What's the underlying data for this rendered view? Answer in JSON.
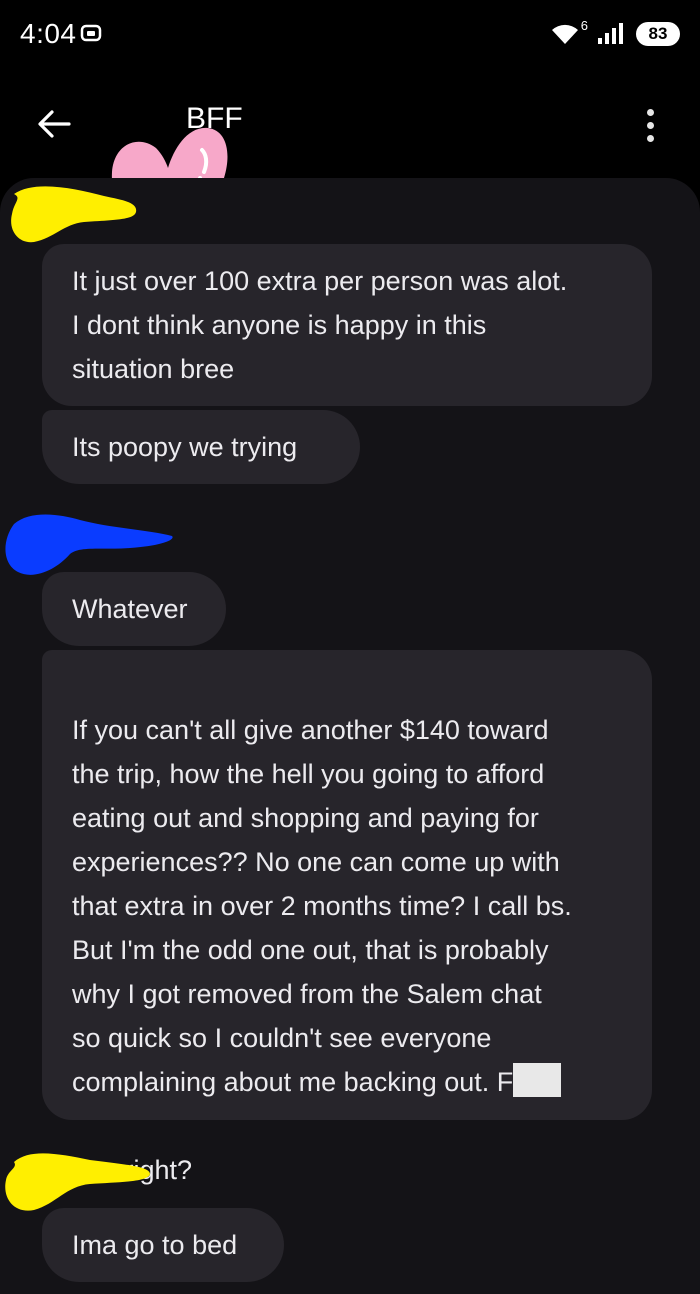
{
  "status_bar": {
    "time": "4:04",
    "wifi_label": "6",
    "battery": "83"
  },
  "header": {
    "contact_name": "BFF",
    "back_icon": "arrow-left-icon",
    "more_icon": "more-vertical-icon"
  },
  "messages": [
    {
      "text": "It just over 100 extra per person was alot.\nI dont think anyone is happy in this\nsituation bree"
    },
    {
      "text": "Its poopy we trying"
    },
    {
      "text": "Whatever"
    },
    {
      "text": "If you can't all give another $140 toward\nthe trip, how the hell you going to afford\neating out and shopping and paying for\nexperiences?? No one can come up with\nthat extra in over 2 months time? I call bs.\nBut I'm the odd one out, that is probably\nwhy I got removed from the Salem chat\nso quick so I couldn't see everyone\ncomplaining about me backing out. F"
    },
    {
      "text": "me, right?"
    },
    {
      "text": "Ima go to bed"
    }
  ],
  "colors": {
    "background": "#000000",
    "conversation_bg": "#141317",
    "bubble": "#27252b",
    "text": "#ecebef",
    "heart": "#f7a8c9",
    "yellow_scribble": "#ffef00",
    "blue_scribble": "#0a3cff"
  }
}
